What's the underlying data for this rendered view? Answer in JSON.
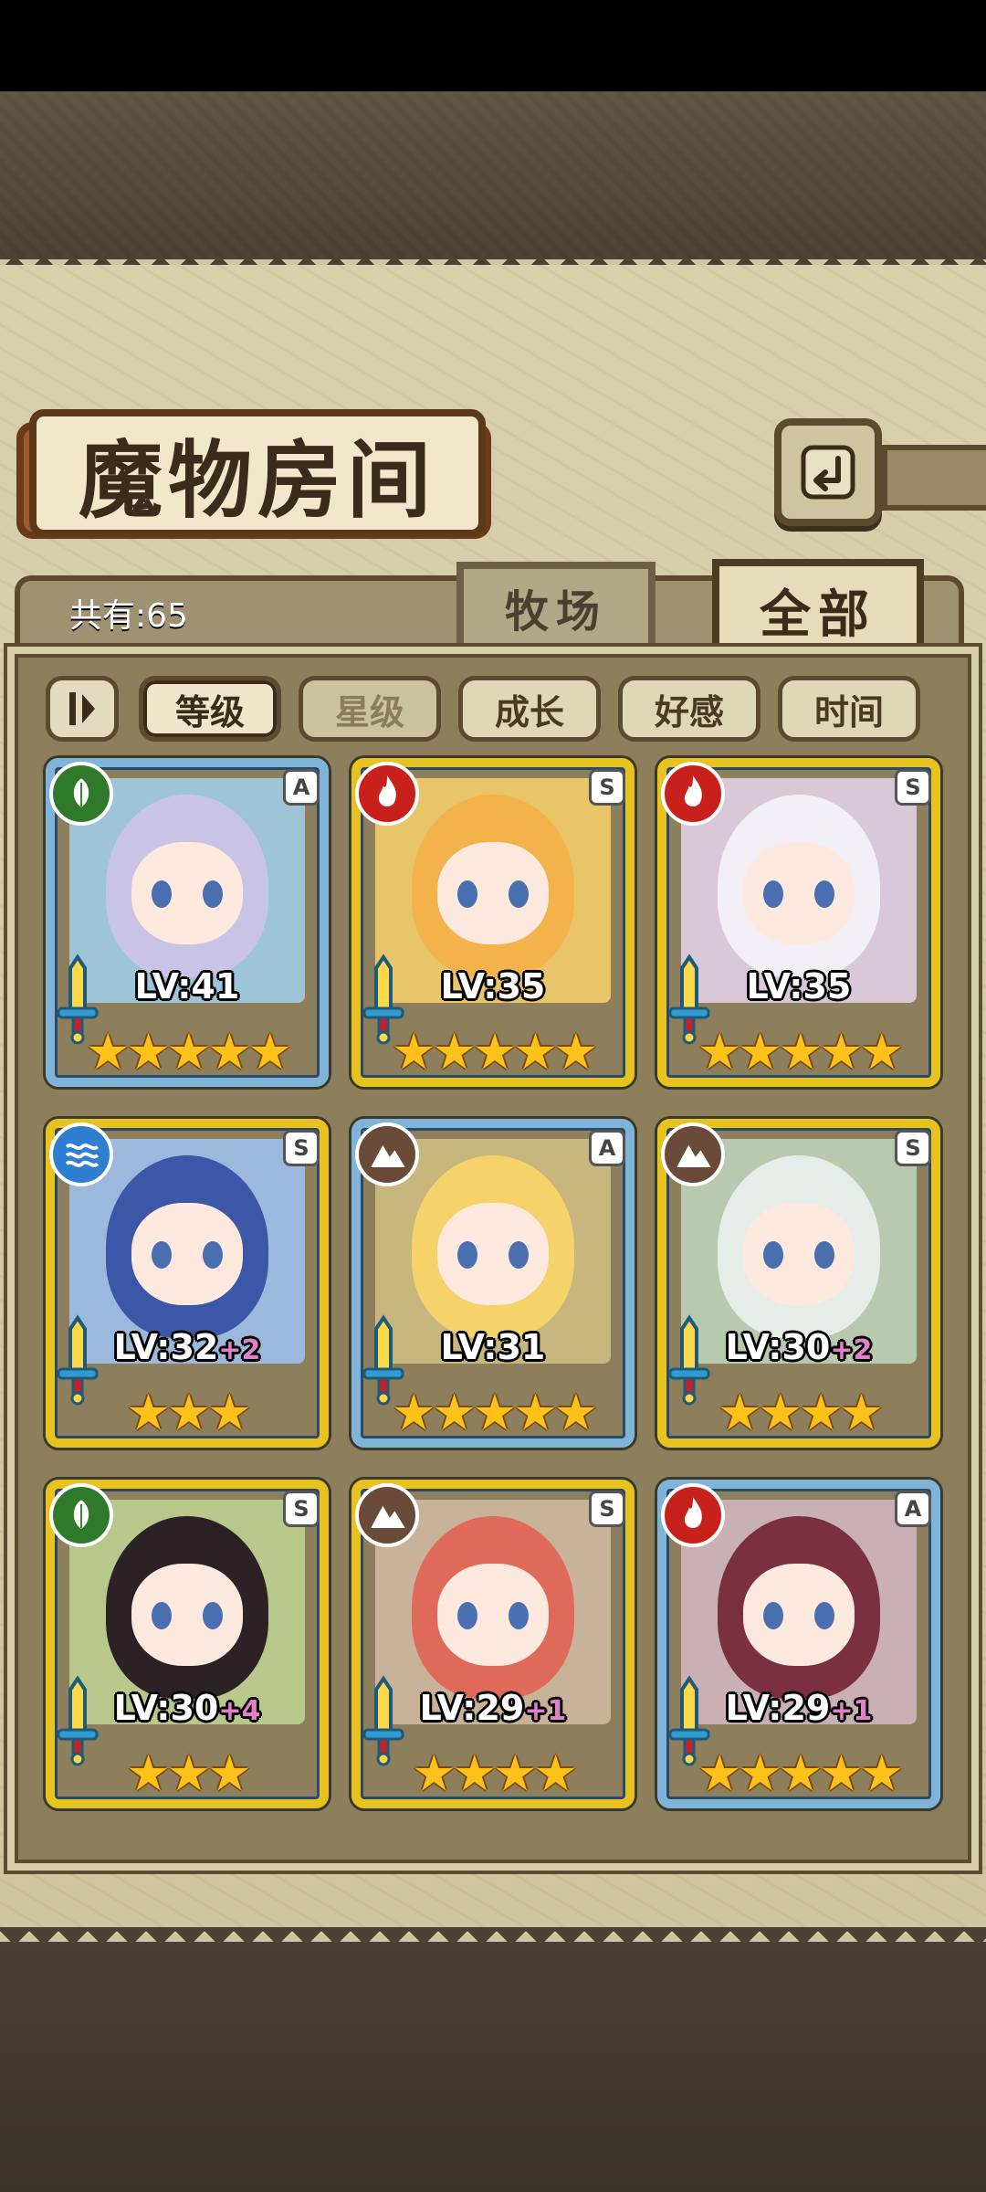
{
  "header": {
    "title": "魔物房间"
  },
  "count": {
    "label": "共有:65"
  },
  "tabs": {
    "ranch": "牧场",
    "all": "全部"
  },
  "sort": {
    "options": [
      "等级",
      "星级",
      "成长",
      "好感",
      "时间"
    ],
    "selected": "等级"
  },
  "monsters": [
    {
      "level": "LV:41",
      "plus": "",
      "stars": "★★★★★",
      "rank": "A",
      "element": "leaf-icon",
      "frame": "blue"
    },
    {
      "level": "LV:35",
      "plus": "",
      "stars": "★★★★★",
      "rank": "S",
      "element": "fire-icon",
      "frame": "gold"
    },
    {
      "level": "LV:35",
      "plus": "",
      "stars": "★★★★★",
      "rank": "S",
      "element": "fire-icon",
      "frame": "gold"
    },
    {
      "level": "LV:32",
      "plus": "+2",
      "stars": "★★★",
      "rank": "S",
      "element": "water-icon",
      "frame": "gold"
    },
    {
      "level": "LV:31",
      "plus": "",
      "stars": "★★★★★",
      "rank": "A",
      "element": "earth-icon",
      "frame": "blue"
    },
    {
      "level": "LV:30",
      "plus": "+2",
      "stars": "★★★★",
      "rank": "S",
      "element": "earth-icon",
      "frame": "gold"
    },
    {
      "level": "LV:30",
      "plus": "+4",
      "stars": "★★★",
      "rank": "S",
      "element": "leaf-icon",
      "frame": "gold"
    },
    {
      "level": "LV:29",
      "plus": "+1",
      "stars": "★★★★",
      "rank": "S",
      "element": "earth-icon",
      "frame": "gold"
    },
    {
      "level": "LV:29",
      "plus": "+1",
      "stars": "★★★★★",
      "rank": "A",
      "element": "fire-icon",
      "frame": "blue"
    }
  ],
  "colors": {
    "frame_gold": "#e8c21e",
    "frame_blue": "#7fb4d8",
    "leaf": "#2f7a2a",
    "fire": "#c8201a",
    "water": "#2f7fd0",
    "earth": "#6a4a38",
    "plus": "#e080c8",
    "star": "#ffc21a"
  }
}
